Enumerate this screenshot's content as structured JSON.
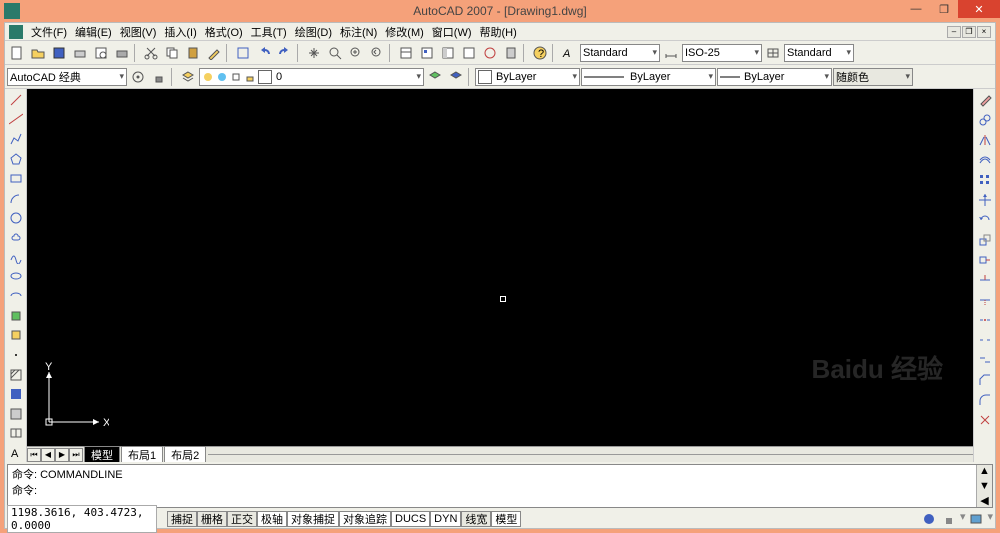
{
  "title": "AutoCAD 2007 - [Drawing1.dwg]",
  "menus": [
    "文件(F)",
    "编辑(E)",
    "视图(V)",
    "插入(I)",
    "格式(O)",
    "工具(T)",
    "绘图(D)",
    "标注(N)",
    "修改(M)",
    "窗口(W)",
    "帮助(H)"
  ],
  "style_combo1": "Standard",
  "style_combo2": "ISO-25",
  "style_combo3": "Standard",
  "workspace_combo": "AutoCAD 经典",
  "layer_combo": "0",
  "color_combo": "ByLayer",
  "linetype_combo": "ByLayer",
  "lineweight_combo": "ByLayer",
  "plotstyle_combo": "随颜色",
  "tabs": {
    "active": "模型",
    "others": [
      "布局1",
      "布局2"
    ]
  },
  "cmd": {
    "line1": "命令:  COMMANDLINE",
    "line2": "命令:"
  },
  "status": {
    "coords": "1198.3616, 403.4723, 0.0000",
    "buttons": [
      "捕捉",
      "栅格",
      "正交",
      "极轴",
      "对象捕捉",
      "对象追踪",
      "DUCS",
      "DYN",
      "线宽",
      "模型"
    ]
  },
  "ucs": {
    "x": "X",
    "y": "Y"
  },
  "watermark": "Baidu 经验"
}
